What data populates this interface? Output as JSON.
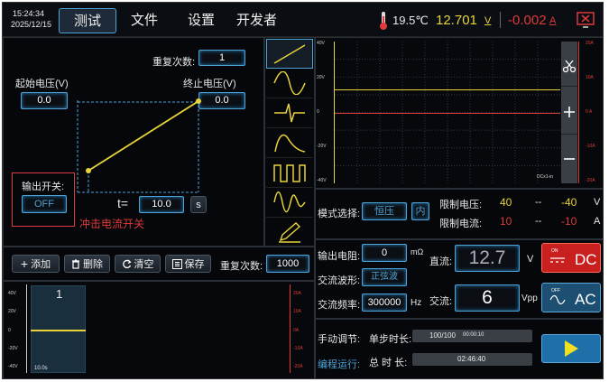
{
  "status": {
    "time": "15:24:34",
    "date": "2025/12/15"
  },
  "menu": {
    "test": "测试",
    "file": "文件",
    "settings": "设置",
    "developer": "开发者"
  },
  "header": {
    "temperature": "19.5℃",
    "voltage": "12.701",
    "voltage_unit": "V",
    "current": "-0.002",
    "current_unit": "A"
  },
  "ramp": {
    "repeat_label": "重复次数:",
    "repeat_value": "1",
    "start_label": "起始电压(V)",
    "start_value": "0.0",
    "end_label": "终止电压(V)",
    "end_value": "0.0",
    "output_label": "输出开关:",
    "output_value": "OFF",
    "t_label": "t=",
    "t_value": "10.0",
    "t_unit": "s",
    "annotation": "冲击电流开关"
  },
  "waveforms": [
    "ramp-icon",
    "sine-icon",
    "pulse-icon",
    "decay-icon",
    "square-icon",
    "damped-sine-icon",
    "pen-icon"
  ],
  "scope": {
    "left_ticks": [
      "40V",
      "20V",
      "0",
      "-20V",
      "-40V"
    ],
    "right_ticks": [
      "20A",
      "10A",
      "0 A",
      "-10A",
      "-20A"
    ],
    "corner": "DCx1-in",
    "yellow_level": 13,
    "red_level": 0,
    "ylim": [
      -40,
      40
    ]
  },
  "side_tools": [
    "scissors-icon",
    "plus-icon",
    "minus-icon"
  ],
  "mode": {
    "label": "模式选择:",
    "value": "恒压",
    "inner": "内"
  },
  "limits": {
    "voltage_label": "限制电压:",
    "voltage_max": "40",
    "voltage_sep": "--",
    "voltage_min": "-40",
    "voltage_unit": "V",
    "current_label": "限制电流:",
    "current_max": "10",
    "current_sep": "--",
    "current_min": "-10",
    "current_unit": "A"
  },
  "output": {
    "resistance_label": "输出电阻:",
    "resistance_value": "0",
    "resistance_unit": "mΩ",
    "ac_wave_label": "交流波形:",
    "ac_wave_value": "正弦波",
    "ac_freq_label": "交流频率:",
    "ac_freq_value": "300000",
    "ac_freq_unit": "Hz",
    "dc_label": "直流:",
    "dc_value": "12.7",
    "dc_unit": "V",
    "ac_label": "交流:",
    "ac_value": "6",
    "ac_unit": "Vpp",
    "dc_button": "DC",
    "dc_button_state": "ON",
    "ac_button": "AC",
    "ac_button_state": "OFF"
  },
  "toolbar": {
    "add": "添加",
    "delete": "删除",
    "clear": "清空",
    "save": "保存",
    "repeat_label": "重复次数:",
    "repeat_value": "1000"
  },
  "sequence": {
    "left_ticks": [
      "40V",
      "20V",
      "0",
      "-20V",
      "-40V"
    ],
    "right_ticks": [
      "20A",
      "10A",
      "0A",
      "-10A",
      "-20A"
    ],
    "step_number": "1",
    "step_time": "10.0s"
  },
  "manual": {
    "label": "手动调节:",
    "run_label": "编程运行:",
    "step_label": "单步时长:",
    "step_value": "100/100",
    "step_time": "00:00:10",
    "total_label": "总 时 长:",
    "total_value": "02:46:40"
  },
  "colors": {
    "accent": "#4ea3d6",
    "yellow": "#e8d43a",
    "red": "#e03a3a"
  }
}
